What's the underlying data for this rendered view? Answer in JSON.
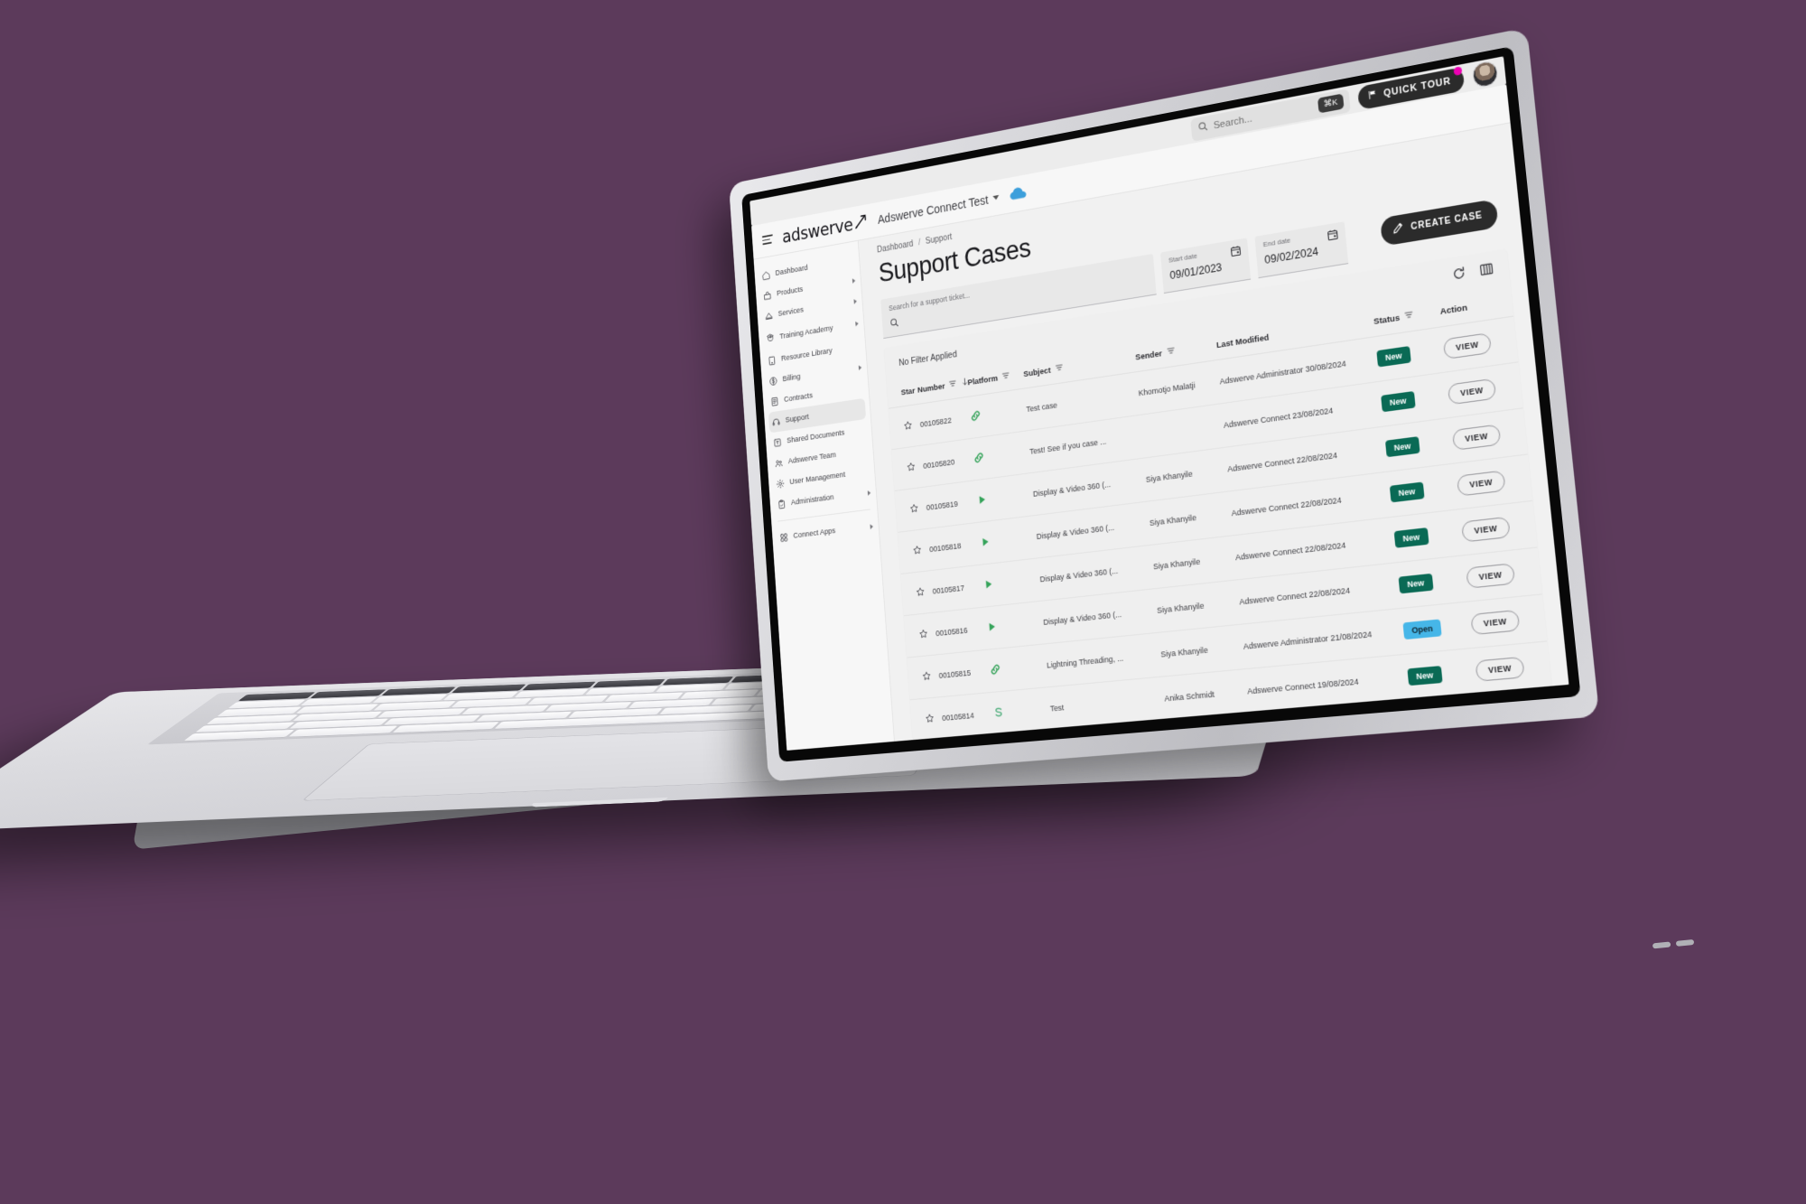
{
  "os_bar": {
    "search_placeholder": "Search...",
    "shortcut": "⌘K",
    "quick_tour_label": "QUICK TOUR",
    "flag_icon": "flag-icon",
    "avatar_icon": "avatar"
  },
  "app_header": {
    "menu_icon": "hamburger-menu-icon",
    "logo_text": "adswerve",
    "logo_mark": "arrow-swoosh-icon",
    "org_name": "Adswerve Connect Test",
    "org_caret_icon": "chevron-down-icon",
    "cloud_icon": "cloud-icon"
  },
  "sidebar": {
    "items": [
      {
        "label": "Dashboard",
        "icon": "home-icon",
        "expandable": false,
        "active": false
      },
      {
        "label": "Products",
        "icon": "box-icon",
        "expandable": true,
        "active": false
      },
      {
        "label": "Services",
        "icon": "services-icon",
        "expandable": true,
        "active": false
      },
      {
        "label": "Training Academy",
        "icon": "academy-icon",
        "expandable": true,
        "active": false,
        "two_line": true
      },
      {
        "label": "Resource Library",
        "icon": "book-icon",
        "expandable": false,
        "active": false
      },
      {
        "label": "Billing",
        "icon": "dollar-icon",
        "expandable": true,
        "active": false
      },
      {
        "label": "Contracts",
        "icon": "contract-icon",
        "expandable": false,
        "active": false
      },
      {
        "label": "Support",
        "icon": "support-icon",
        "expandable": false,
        "active": true
      },
      {
        "label": "Shared Documents",
        "icon": "document-icon",
        "expandable": false,
        "active": false
      },
      {
        "label": "Adswerve Team",
        "icon": "people-icon",
        "expandable": false,
        "active": false
      },
      {
        "label": "User Management",
        "icon": "gear-icon",
        "expandable": false,
        "active": false
      },
      {
        "label": "Administration",
        "icon": "clipboard-icon",
        "expandable": true,
        "active": false
      }
    ],
    "footer_items": [
      {
        "label": "Connect Apps",
        "icon": "grid-apps-icon",
        "expandable": true,
        "active": false
      }
    ]
  },
  "main": {
    "breadcrumb": {
      "root": "Dashboard",
      "separator": "/",
      "current": "Support"
    },
    "page_title": "Support Cases",
    "create_case_label": "CREATE CASE",
    "create_case_icon": "pencil-icon",
    "search": {
      "placeholder": "Search for a support ticket...",
      "value": "",
      "icon": "search-icon"
    },
    "start_date": {
      "label": "Start date",
      "value": "09/01/2023",
      "icon": "calendar-icon"
    },
    "end_date": {
      "label": "End date",
      "value": "09/02/2024",
      "icon": "calendar-icon"
    },
    "filter_status": "No Filter Applied",
    "tools": [
      {
        "name": "refresh-icon"
      },
      {
        "name": "columns-icon"
      }
    ],
    "table": {
      "columns": [
        {
          "key": "star",
          "label": "Star",
          "filter": false,
          "sort": false
        },
        {
          "key": "number",
          "label": "Number",
          "filter": true,
          "sort": true,
          "sort_dir": "desc"
        },
        {
          "key": "platform",
          "label": "Platform",
          "filter": true,
          "sort": false
        },
        {
          "key": "subject",
          "label": "Subject",
          "filter": true,
          "sort": false
        },
        {
          "key": "sender",
          "label": "Sender",
          "filter": true,
          "sort": false
        },
        {
          "key": "modified",
          "label": "Last Modified",
          "filter": false,
          "sort": false
        },
        {
          "key": "status",
          "label": "Status",
          "filter": true,
          "sort": false
        },
        {
          "key": "action",
          "label": "Action",
          "filter": false,
          "sort": false
        }
      ],
      "rows": [
        {
          "star": "☆",
          "number": "00105822",
          "platform_icon": "link-icon",
          "subject": "Test case",
          "sender": "Khomotjo Malatji",
          "modified": "Adswerve Administrator 30/08/2024",
          "status": "New",
          "status_kind": "new",
          "action": "VIEW"
        },
        {
          "star": "☆",
          "number": "00105820",
          "platform_icon": "link-icon",
          "subject": "Test! See if you case ...",
          "sender": "",
          "modified": "Adswerve Connect 23/08/2024",
          "status": "New",
          "status_kind": "new",
          "action": "VIEW"
        },
        {
          "star": "☆",
          "number": "00105819",
          "platform_icon": "play-icon",
          "subject": "Display & Video 360 (...",
          "sender": "Siya Khanyile",
          "modified": "Adswerve Connect 22/08/2024",
          "status": "New",
          "status_kind": "new",
          "action": "VIEW"
        },
        {
          "star": "☆",
          "number": "00105818",
          "platform_icon": "play-icon",
          "subject": "Display & Video 360 (...",
          "sender": "Siya Khanyile",
          "modified": "Adswerve Connect 22/08/2024",
          "status": "New",
          "status_kind": "new",
          "action": "VIEW"
        },
        {
          "star": "☆",
          "number": "00105817",
          "platform_icon": "play-icon",
          "subject": "Display & Video 360 (...",
          "sender": "Siya Khanyile",
          "modified": "Adswerve Connect 22/08/2024",
          "status": "New",
          "status_kind": "new",
          "action": "VIEW"
        },
        {
          "star": "☆",
          "number": "00105816",
          "platform_icon": "play-icon",
          "subject": "Display & Video 360 (...",
          "sender": "Siya Khanyile",
          "modified": "Adswerve Connect 22/08/2024",
          "status": "New",
          "status_kind": "new",
          "action": "VIEW"
        },
        {
          "star": "☆",
          "number": "00105815",
          "platform_icon": "link-icon",
          "subject": "Lightning Threading, ...",
          "sender": "Siya Khanyile",
          "modified": "Adswerve Administrator 21/08/2024",
          "status": "Open",
          "status_kind": "open",
          "action": "VIEW"
        },
        {
          "star": "☆",
          "number": "00105814",
          "platform_icon": "analytics-icon",
          "subject": "Test",
          "sender": "Anika Schmidt",
          "modified": "Adswerve Connect 19/08/2024",
          "status": "New",
          "status_kind": "new",
          "action": "VIEW"
        }
      ]
    }
  },
  "colors": {
    "background": "#5c3a5b",
    "status_new": "#0a6a55",
    "status_open": "#46b6e8",
    "platform_green": "#3aa757",
    "accent_dark": "#2b2b2b",
    "notification_dot": "#ee00b4"
  }
}
